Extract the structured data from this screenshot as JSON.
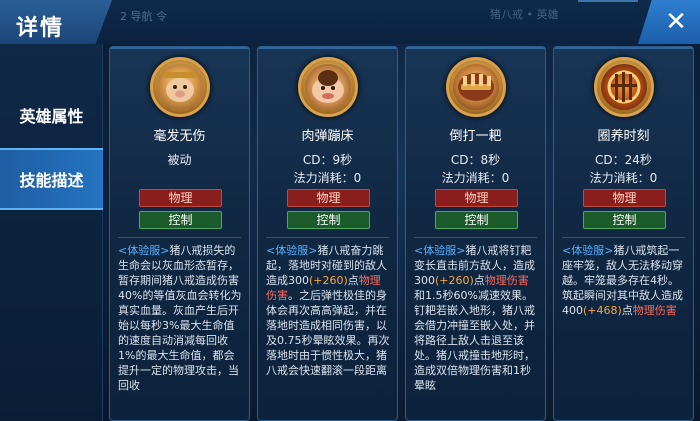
{
  "header": {
    "title": "详情",
    "ghost_left": "2 导航 令",
    "ghost_right": "猪八戒 • 英雄"
  },
  "sidebar": {
    "items": [
      {
        "label": "英雄属性"
      },
      {
        "label": "技能描述"
      }
    ]
  },
  "colors": {
    "accent": "#2473c0",
    "physical": "#8a1e1e",
    "control": "#1b5a2a",
    "number": "#ffa53d"
  },
  "skills": [
    {
      "name": "毫发无伤",
      "icon": "boar-shield-icon",
      "stat1": "被动",
      "stat2": "",
      "tag_phys": "物理",
      "tag_ctrl": "控制",
      "desc_exp": "<体验服>",
      "desc_a": "猪八戒损失的生命会以灰血形态暂存，暂存期间猪八戒造成伤害40%的等值灰血会转化为真实血量。灰血产生后开始以每秒3%最大生命值的速度自动消减每回收1%的最大生命值，都会提升一定的物理攻击，当回收",
      "desc_num": "",
      "desc_b": "",
      "desc_dmg": "",
      "desc_c": ""
    },
    {
      "name": "肉弹蹦床",
      "icon": "belly-bounce-icon",
      "stat1": "CD：9秒",
      "stat2": "法力消耗：0",
      "tag_phys": "物理",
      "tag_ctrl": "控制",
      "desc_exp": "<体验服>",
      "desc_a": "猪八戒奋力跳起，落地时对碰到的敌人造成300",
      "desc_num": "(+260)",
      "desc_b": "点",
      "desc_dmg": "物理伤害",
      "desc_c": "。之后弹性极佳的身体会再次高高弹起，并在落地时造成相同伤害，以及0.75秒晕眩效果。再次落地时由于惯性极大，猪八戒会快速翻滚一段距离"
    },
    {
      "name": "倒打一耙",
      "icon": "rake-strike-icon",
      "stat1": "CD：8秒",
      "stat2": "法力消耗：0",
      "tag_phys": "物理",
      "tag_ctrl": "控制",
      "desc_exp": "<体验服>",
      "desc_a": "猪八戒将钉耙变长直击前方敌人，造成300",
      "desc_num": "(+260)",
      "desc_b": "点",
      "desc_dmg": "物理伤害",
      "desc_c": "和1.5秒60%减速效果。钉耙若嵌入地形，猪八戒会借力冲撞至嵌入处，并将路径上敌人击退至该处。猪八戒撞击地形时，造成双倍物理伤害和1秒晕眩"
    },
    {
      "name": "圈养时刻",
      "icon": "cage-trap-icon",
      "stat1": "CD：24秒",
      "stat2": "法力消耗：0",
      "tag_phys": "物理",
      "tag_ctrl": "控制",
      "desc_exp": "<体验服>",
      "desc_a": "猪八戒筑起一座牢笼，敌人无法移动穿越。牢笼最多存在4秒。筑起瞬间对其中敌人造成400",
      "desc_num": "(+468)",
      "desc_b": "点",
      "desc_dmg": "物理伤害",
      "desc_c": ""
    }
  ]
}
